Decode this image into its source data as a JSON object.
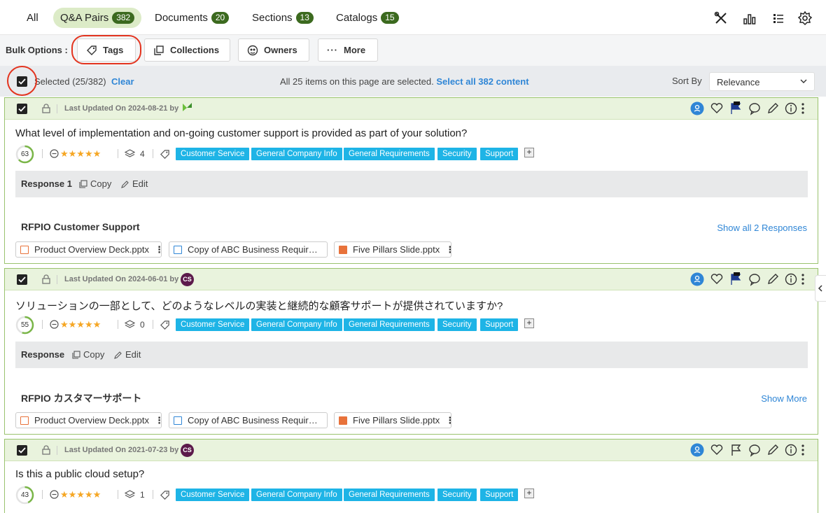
{
  "tabs": [
    {
      "label": "All",
      "count": null
    },
    {
      "label": "Q&A Pairs",
      "count": "382"
    },
    {
      "label": "Documents",
      "count": "20"
    },
    {
      "label": "Sections",
      "count": "13"
    },
    {
      "label": "Catalogs",
      "count": "15"
    }
  ],
  "toolbar_icons": [
    "tools-icon",
    "bar-chart-icon",
    "list-filter-icon",
    "gear-icon"
  ],
  "bulk": {
    "label": "Bulk Options :",
    "buttons": [
      "Tags",
      "Collections",
      "Owners",
      "More"
    ]
  },
  "selection": {
    "text": "Selected (25/382)",
    "clear": "Clear",
    "page_msg": "All 25 items on this page are selected.",
    "select_all": "Select all 382 content",
    "sort_label": "Sort By",
    "sort_value": "Relevance"
  },
  "colors": {
    "accent": "#2f86d6",
    "tag": "#1eb4e6",
    "card_border": "#9ac36e",
    "count_badge": "#3c6a1f"
  },
  "cards": [
    {
      "updated": "Last Updated On 2024-08-21 by",
      "avatar": "",
      "question": "What level of implementation and on-going customer support is provided as part of your solution?",
      "score": "63",
      "score_fraction": 0.63,
      "stars": "★★★★★",
      "layers": "4",
      "tags": [
        "Customer Service",
        "General Company Info",
        "General Requirements",
        "Security",
        "Support"
      ],
      "response_label": "Response 1",
      "copy": "Copy",
      "edit": "Edit",
      "answer": "RFPIO Customer Support",
      "show_link": "Show all 2 Responses",
      "files": [
        "Product Overview Deck.pptx",
        "Copy of ABC Business Requir…",
        "Five Pillars Slide.pptx"
      ]
    },
    {
      "updated": "Last Updated On 2024-06-01 by",
      "avatar": "CS",
      "question": "ソリューションの一部として、どのようなレベルの実装と継続的な顧客サポートが提供されていますか?",
      "score": "55",
      "score_fraction": 0.55,
      "stars": "★★★★★",
      "layers": "0",
      "tags": [
        "Customer Service",
        "General Company Info",
        "General Requirements",
        "Security",
        "Support"
      ],
      "response_label": "Response",
      "copy": "Copy",
      "edit": "Edit",
      "answer": "RFPIO カスタマーサポート",
      "show_link": "Show More",
      "files": [
        "Product Overview Deck.pptx",
        "Copy of ABC Business Requir…",
        "Five Pillars Slide.pptx"
      ]
    },
    {
      "updated": "Last Updated On 2021-07-23 by",
      "avatar": "CS",
      "question": "Is this a public cloud setup?",
      "score": "43",
      "score_fraction": 0.43,
      "stars": "★★★★★",
      "layers": "1",
      "tags": [
        "Customer Service",
        "General Company Info",
        "General Requirements",
        "Security",
        "Support"
      ]
    }
  ]
}
